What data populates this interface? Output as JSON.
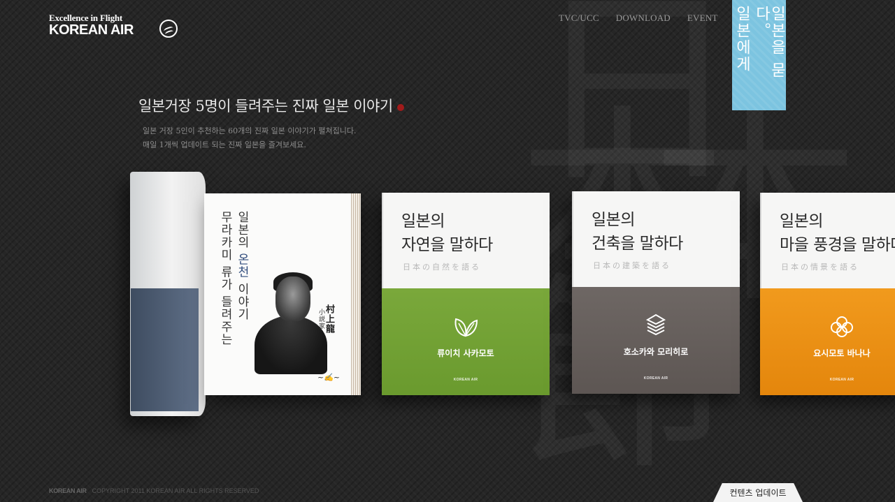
{
  "header": {
    "logo_tagline": "Excellence in Flight",
    "logo_name": "KOREAN AIR",
    "nav": [
      "TVC/UCC",
      "DOWNLOAD",
      "EVENT"
    ],
    "banner_columns": [
      "일본을 묻다。",
      "일본에게"
    ]
  },
  "intro": {
    "headline": "일본거장 5명이 들려주는 진짜 일본 이야기",
    "desc_line1": "일본 거장 5인이 추천하는 60개의 진짜 일본 이야기가 펼쳐집니다.",
    "desc_line2": "매일 1개씩 업데이트 되는 진짜 일본을 즐겨보세요."
  },
  "open_book": {
    "line1_pre": "일본의 ",
    "line1_hl": "온천",
    "line1_post": " 이야기",
    "line2": "무라카미 류가 들려주는",
    "author_kanji": "村上龍",
    "author_role": "小説家"
  },
  "books": [
    {
      "title_line1": "일본의",
      "title_line2": "자연을 말하다",
      "subtitle": "日本の自然を語る",
      "author": "류이치 사카모토",
      "icon": "leaf-icon",
      "color": "#6f9f33"
    },
    {
      "title_line1": "일본의",
      "title_line2": "건축을 말하다",
      "subtitle": "日本の建築を語る",
      "author": "호소카와 모리히로",
      "icon": "pagoda-icon",
      "color": "#655e5b"
    },
    {
      "title_line1": "일본의",
      "title_line2": "마을 풍경을 말하다",
      "subtitle": "日本の情景を語る",
      "author": "요시모토 바나나",
      "icon": "flower-crest-icon",
      "color": "#ea8f14"
    }
  ],
  "book_logo": "KOREAN AIR",
  "footer": {
    "logo": "KOREAN AIR",
    "copyright": "COPYRIGHT 2011 KOREAN AIR ALL RIGHTS RESERVED"
  },
  "update_tab": "컨텐츠 업데이트"
}
